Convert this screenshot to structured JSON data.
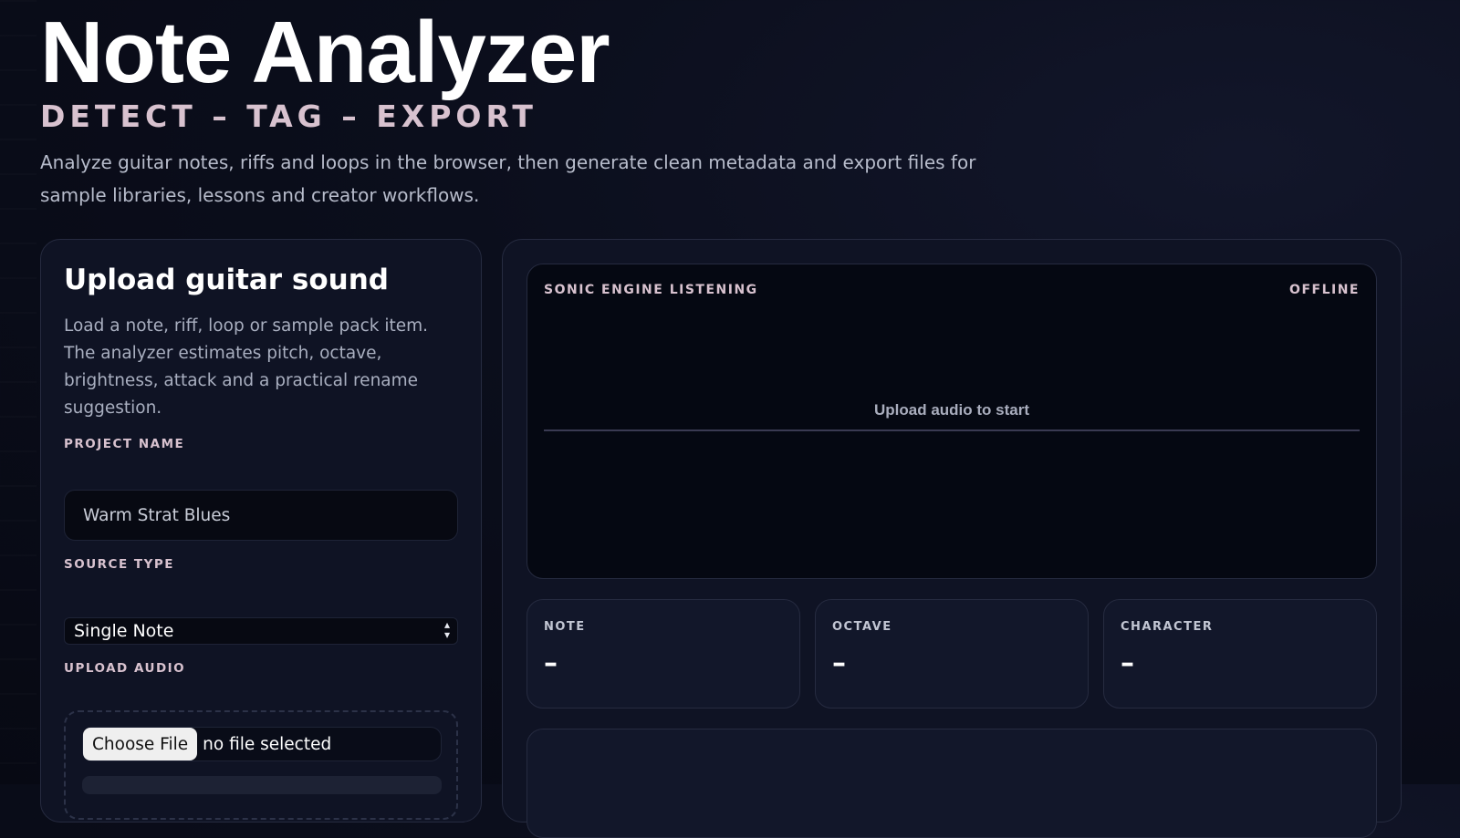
{
  "app": {
    "title": "Note Analyzer",
    "tagline": "DETECT – TAG – EXPORT",
    "description": "Analyze guitar notes, riffs and loops in the browser, then generate clean metadata and export files for sample libraries, lessons and creator workflows."
  },
  "upload": {
    "title": "Upload guitar sound",
    "description": "Load a note, riff, loop or sample pack item. The analyzer estimates pitch, octave, brightness, attack and a practical rename suggestion.",
    "project_label": "PROJECT NAME",
    "project_value": "Warm Strat Blues",
    "source_label": "SOURCE TYPE",
    "source_value": "Single Note",
    "audio_label": "UPLOAD AUDIO",
    "choose_button": "Choose File",
    "file_status": "no file selected"
  },
  "engine": {
    "label": "SONIC ENGINE LISTENING",
    "status": "OFFLINE",
    "empty_message": "Upload audio to start"
  },
  "stats": [
    {
      "label": "NOTE",
      "value": "–"
    },
    {
      "label": "OCTAVE",
      "value": "–"
    },
    {
      "label": "CHARACTER",
      "value": "–"
    }
  ],
  "colors": {
    "background": "#0b0e1c",
    "card": "#0f1324",
    "accent_label": "#d8c2cf",
    "border": "#262b40"
  }
}
